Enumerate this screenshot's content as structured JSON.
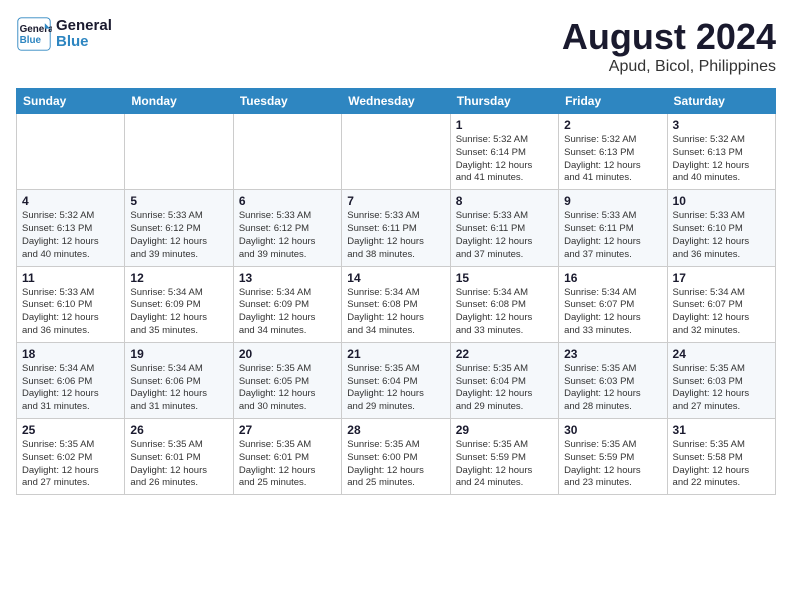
{
  "header": {
    "logo_line1": "General",
    "logo_line2": "Blue",
    "month_year": "August 2024",
    "location": "Apud, Bicol, Philippines"
  },
  "weekdays": [
    "Sunday",
    "Monday",
    "Tuesday",
    "Wednesday",
    "Thursday",
    "Friday",
    "Saturday"
  ],
  "weeks": [
    [
      {
        "day": "",
        "info": ""
      },
      {
        "day": "",
        "info": ""
      },
      {
        "day": "",
        "info": ""
      },
      {
        "day": "",
        "info": ""
      },
      {
        "day": "1",
        "info": "Sunrise: 5:32 AM\nSunset: 6:14 PM\nDaylight: 12 hours\nand 41 minutes."
      },
      {
        "day": "2",
        "info": "Sunrise: 5:32 AM\nSunset: 6:13 PM\nDaylight: 12 hours\nand 41 minutes."
      },
      {
        "day": "3",
        "info": "Sunrise: 5:32 AM\nSunset: 6:13 PM\nDaylight: 12 hours\nand 40 minutes."
      }
    ],
    [
      {
        "day": "4",
        "info": "Sunrise: 5:32 AM\nSunset: 6:13 PM\nDaylight: 12 hours\nand 40 minutes."
      },
      {
        "day": "5",
        "info": "Sunrise: 5:33 AM\nSunset: 6:12 PM\nDaylight: 12 hours\nand 39 minutes."
      },
      {
        "day": "6",
        "info": "Sunrise: 5:33 AM\nSunset: 6:12 PM\nDaylight: 12 hours\nand 39 minutes."
      },
      {
        "day": "7",
        "info": "Sunrise: 5:33 AM\nSunset: 6:11 PM\nDaylight: 12 hours\nand 38 minutes."
      },
      {
        "day": "8",
        "info": "Sunrise: 5:33 AM\nSunset: 6:11 PM\nDaylight: 12 hours\nand 37 minutes."
      },
      {
        "day": "9",
        "info": "Sunrise: 5:33 AM\nSunset: 6:11 PM\nDaylight: 12 hours\nand 37 minutes."
      },
      {
        "day": "10",
        "info": "Sunrise: 5:33 AM\nSunset: 6:10 PM\nDaylight: 12 hours\nand 36 minutes."
      }
    ],
    [
      {
        "day": "11",
        "info": "Sunrise: 5:33 AM\nSunset: 6:10 PM\nDaylight: 12 hours\nand 36 minutes."
      },
      {
        "day": "12",
        "info": "Sunrise: 5:34 AM\nSunset: 6:09 PM\nDaylight: 12 hours\nand 35 minutes."
      },
      {
        "day": "13",
        "info": "Sunrise: 5:34 AM\nSunset: 6:09 PM\nDaylight: 12 hours\nand 34 minutes."
      },
      {
        "day": "14",
        "info": "Sunrise: 5:34 AM\nSunset: 6:08 PM\nDaylight: 12 hours\nand 34 minutes."
      },
      {
        "day": "15",
        "info": "Sunrise: 5:34 AM\nSunset: 6:08 PM\nDaylight: 12 hours\nand 33 minutes."
      },
      {
        "day": "16",
        "info": "Sunrise: 5:34 AM\nSunset: 6:07 PM\nDaylight: 12 hours\nand 33 minutes."
      },
      {
        "day": "17",
        "info": "Sunrise: 5:34 AM\nSunset: 6:07 PM\nDaylight: 12 hours\nand 32 minutes."
      }
    ],
    [
      {
        "day": "18",
        "info": "Sunrise: 5:34 AM\nSunset: 6:06 PM\nDaylight: 12 hours\nand 31 minutes."
      },
      {
        "day": "19",
        "info": "Sunrise: 5:34 AM\nSunset: 6:06 PM\nDaylight: 12 hours\nand 31 minutes."
      },
      {
        "day": "20",
        "info": "Sunrise: 5:35 AM\nSunset: 6:05 PM\nDaylight: 12 hours\nand 30 minutes."
      },
      {
        "day": "21",
        "info": "Sunrise: 5:35 AM\nSunset: 6:04 PM\nDaylight: 12 hours\nand 29 minutes."
      },
      {
        "day": "22",
        "info": "Sunrise: 5:35 AM\nSunset: 6:04 PM\nDaylight: 12 hours\nand 29 minutes."
      },
      {
        "day": "23",
        "info": "Sunrise: 5:35 AM\nSunset: 6:03 PM\nDaylight: 12 hours\nand 28 minutes."
      },
      {
        "day": "24",
        "info": "Sunrise: 5:35 AM\nSunset: 6:03 PM\nDaylight: 12 hours\nand 27 minutes."
      }
    ],
    [
      {
        "day": "25",
        "info": "Sunrise: 5:35 AM\nSunset: 6:02 PM\nDaylight: 12 hours\nand 27 minutes."
      },
      {
        "day": "26",
        "info": "Sunrise: 5:35 AM\nSunset: 6:01 PM\nDaylight: 12 hours\nand 26 minutes."
      },
      {
        "day": "27",
        "info": "Sunrise: 5:35 AM\nSunset: 6:01 PM\nDaylight: 12 hours\nand 25 minutes."
      },
      {
        "day": "28",
        "info": "Sunrise: 5:35 AM\nSunset: 6:00 PM\nDaylight: 12 hours\nand 25 minutes."
      },
      {
        "day": "29",
        "info": "Sunrise: 5:35 AM\nSunset: 5:59 PM\nDaylight: 12 hours\nand 24 minutes."
      },
      {
        "day": "30",
        "info": "Sunrise: 5:35 AM\nSunset: 5:59 PM\nDaylight: 12 hours\nand 23 minutes."
      },
      {
        "day": "31",
        "info": "Sunrise: 5:35 AM\nSunset: 5:58 PM\nDaylight: 12 hours\nand 22 minutes."
      }
    ]
  ]
}
